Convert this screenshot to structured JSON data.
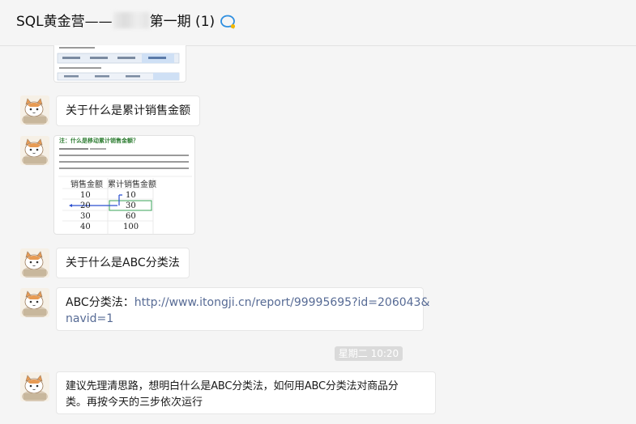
{
  "header": {
    "title_prefix": "SQL黄金营——",
    "title_suffix": "第一期 (1)"
  },
  "messages": [
    {
      "type": "image",
      "desc": "screenshot-table"
    },
    {
      "type": "text",
      "text": "关于什么是累计销售金额"
    },
    {
      "type": "image",
      "heading": "注：什么是移动累计销售金额？",
      "col1": "销售金额",
      "col2": "累计销售金额",
      "rows": [
        [
          "10",
          "10"
        ],
        [
          "20",
          "30"
        ],
        [
          "30",
          "60"
        ],
        [
          "40",
          "100"
        ]
      ]
    },
    {
      "type": "text",
      "text": "关于什么是ABC分类法"
    },
    {
      "type": "text",
      "prefix": "ABC分类法：",
      "link_line1": "http://www.itongji.cn/report/99995695?id=206043&",
      "link_line2": "navid=1"
    },
    {
      "type": "time",
      "text": "星期二 10:20"
    },
    {
      "type": "text",
      "line1": "建议先理清思路，想明白什么是ABC分类法，如何用ABC分类法对商品分",
      "line2": "类。再按今天的三步依次运行"
    }
  ],
  "colors": {
    "link": "#576b95",
    "accent": "#2f8fe0"
  }
}
